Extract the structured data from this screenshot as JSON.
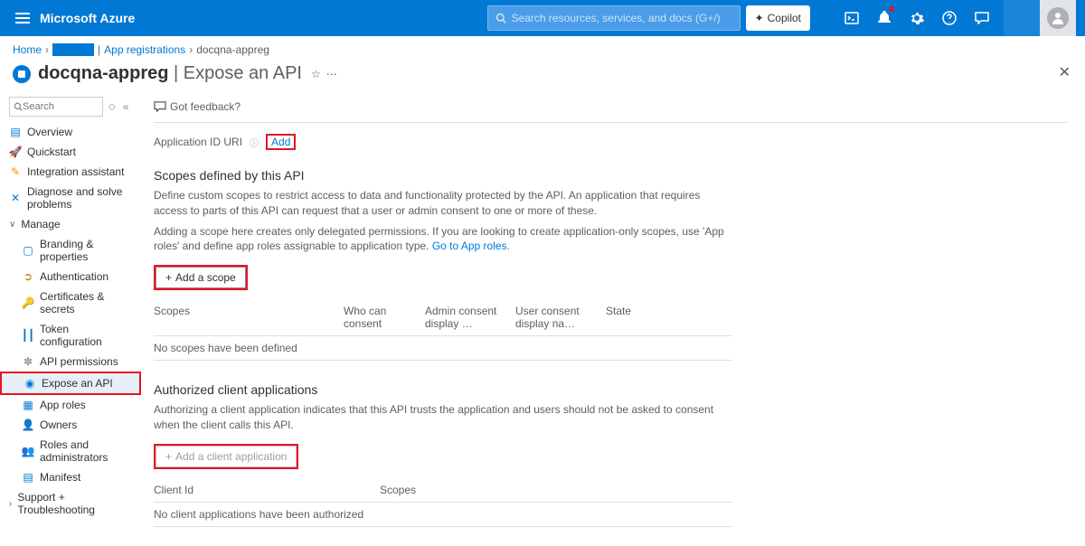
{
  "topbar": {
    "brand": "Microsoft Azure",
    "search_placeholder": "Search resources, services, and docs (G+/)",
    "copilot": "Copilot"
  },
  "breadcrumb": {
    "home": "Home",
    "app_registrations": "App registrations",
    "current": "docqna-appreg"
  },
  "page": {
    "name": "docqna-appreg",
    "section": "Expose an API"
  },
  "sidebar": {
    "search_placeholder": "Search",
    "overview": "Overview",
    "quickstart": "Quickstart",
    "integration": "Integration assistant",
    "diagnose": "Diagnose and solve problems",
    "manage": "Manage",
    "branding": "Branding & properties",
    "authentication": "Authentication",
    "certificates": "Certificates & secrets",
    "token": "Token configuration",
    "api_permissions": "API permissions",
    "expose": "Expose an API",
    "app_roles": "App roles",
    "owners": "Owners",
    "roles": "Roles and administrators",
    "manifest": "Manifest",
    "support": "Support + Troubleshooting"
  },
  "main": {
    "feedback": "Got feedback?",
    "app_id_label": "Application ID URI",
    "add": "Add",
    "scopes_title": "Scopes defined by this API",
    "scopes_desc1": "Define custom scopes to restrict access to data and functionality protected by the API. An application that requires access to parts of this API can request that a user or admin consent to one or more of these.",
    "scopes_desc2a": "Adding a scope here creates only delegated permissions. If you are looking to create application-only scopes, use 'App roles' and define app roles assignable to application type. ",
    "scopes_desc2_link": "Go to App roles",
    "add_scope": "Add a scope",
    "col_scopes": "Scopes",
    "col_who": "Who can consent",
    "col_admin": "Admin consent display …",
    "col_user": "User consent display na…",
    "col_state": "State",
    "empty_scopes": "No scopes have been defined",
    "authorized_title": "Authorized client applications",
    "authorized_desc": "Authorizing a client application indicates that this API trusts the application and users should not be asked to consent when the client calls this API.",
    "add_client": "Add a client application",
    "col_client": "Client Id",
    "col_scopes2": "Scopes",
    "empty_clients": "No client applications have been authorized"
  }
}
